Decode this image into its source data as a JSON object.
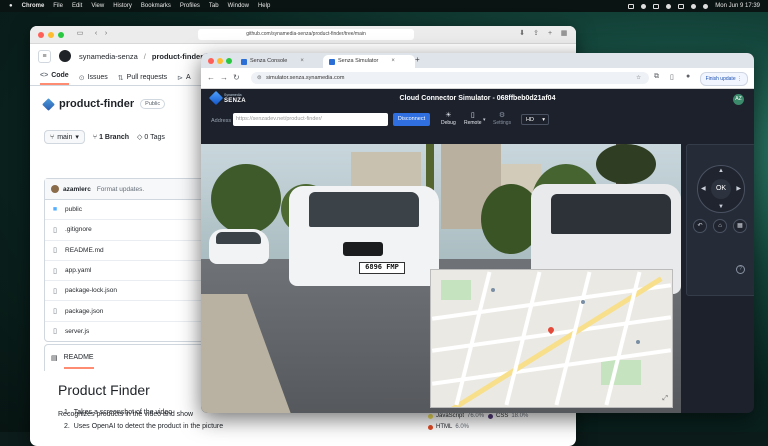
{
  "menubar": {
    "app": "Chrome",
    "items": [
      "File",
      "Edit",
      "View",
      "History",
      "Bookmarks",
      "Profiles",
      "Tab",
      "Window",
      "Help"
    ],
    "clock": "Mon Jun 9  17:39"
  },
  "github": {
    "url": "github.com/synamedia-senza/product-finder/tree/main",
    "owner": "synamedia-senza",
    "repo": "product-finder",
    "tabs": [
      {
        "icon": "<>",
        "label": "Code"
      },
      {
        "icon": "⊙",
        "label": "Issues"
      },
      {
        "icon": "⇅",
        "label": "Pull requests"
      },
      {
        "icon": "⊳",
        "label": "A"
      }
    ],
    "repo_title": "product-finder",
    "visibility": "Public",
    "branch": "main",
    "branches": "1 Branch",
    "tags": "0 Tags",
    "commit_author": "azamlerc",
    "commit_message": "Format updates.",
    "files": [
      {
        "type": "dir",
        "name": "public"
      },
      {
        "type": "file",
        "name": ".gitignore"
      },
      {
        "type": "file",
        "name": "README.md"
      },
      {
        "type": "file",
        "name": "app.yaml"
      },
      {
        "type": "file",
        "name": "package-lock.json"
      },
      {
        "type": "file",
        "name": "package.json"
      },
      {
        "type": "file",
        "name": "server.js"
      }
    ],
    "readme_tab": "README",
    "readme_title": "Product Finder",
    "readme_intro": "Recognizes products in the video and show",
    "readme_steps": [
      "Takes a screenshot of the video",
      "Uses OpenAI to detect the product in the picture"
    ],
    "languages": [
      {
        "name": "JavaScript",
        "pct": "76.0%",
        "color": "#f1e05a"
      },
      {
        "name": "CSS",
        "pct": "18.0%",
        "color": "#563d7c"
      },
      {
        "name": "HTML",
        "pct": "6.0%",
        "color": "#e34c26"
      }
    ]
  },
  "chrome": {
    "tabs": [
      {
        "label": "Senza Console",
        "active": false
      },
      {
        "label": "Senza Simulator",
        "active": true
      }
    ],
    "url": "simulator.senza.synamedia.com",
    "finish_update": "Finish update"
  },
  "senza": {
    "logo_small": "Synamedia",
    "logo_text": "SENZA",
    "title": "Cloud Connector Simulator - 068ffbeb0d21af04",
    "avatar": "AZ",
    "address_label": "Address",
    "address_placeholder": "https://senzadev.net/product-finder/",
    "disconnect": "Disconnect",
    "tools": [
      {
        "icon": "☀",
        "label": "Debug"
      },
      {
        "icon": "▯",
        "label": "Remote"
      },
      {
        "icon": "⚙",
        "label": "Settings"
      }
    ],
    "quality": "HD",
    "plate": "6896 FMP",
    "remote": {
      "ok": "OK",
      "help": "?"
    }
  }
}
